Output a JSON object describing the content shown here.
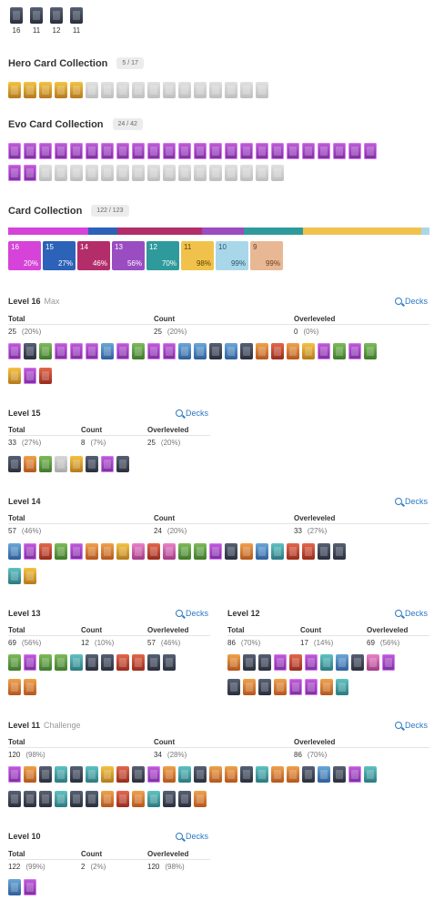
{
  "top_badges": [
    "16",
    "11",
    "12",
    "11"
  ],
  "hero": {
    "title": "Hero Card Collection",
    "count": "5 / 17"
  },
  "evo": {
    "title": "Evo Card Collection",
    "count": "24 / 42"
  },
  "collection": {
    "title": "Card Collection",
    "count": "122 / 123",
    "rarity_tiles": [
      {
        "level": "16",
        "pct": "20%",
        "color": "#d543d9",
        "fill": "#8b2d9b"
      },
      {
        "level": "15",
        "pct": "27%",
        "color": "#2c62b8",
        "fill": "#23408a"
      },
      {
        "level": "14",
        "pct": "46%",
        "color": "#b32d6a",
        "fill": "#8c1f4f"
      },
      {
        "level": "13",
        "pct": "56%",
        "color": "#9a4cc1",
        "fill": "#6e3092"
      },
      {
        "level": "12",
        "pct": "70%",
        "color": "#2f9a9c",
        "fill": "#1f6d72"
      },
      {
        "level": "11",
        "pct": "98%",
        "color": "#f1c24b",
        "fill": "#f1c24b"
      },
      {
        "level": "10",
        "pct": "99%",
        "color": "#a9d7ea",
        "fill": "#a9d7ea"
      },
      {
        "level": "9",
        "pct": "99%",
        "color": "#e8b895",
        "fill": "#e8b895"
      }
    ]
  },
  "labels": {
    "total": "Total",
    "count": "Count",
    "overleveled": "Overleveled",
    "decks": "Decks"
  },
  "levels": {
    "l16": {
      "title": "Level 16",
      "sub": "Max",
      "total": "25",
      "total_pct": "(20%)",
      "count": "25",
      "count_pct": "(20%)",
      "over": "0",
      "over_pct": "(0%)"
    },
    "l15": {
      "title": "Level 15",
      "total": "33",
      "total_pct": "(27%)",
      "count": "8",
      "count_pct": "(7%)",
      "over": "25",
      "over_pct": "(20%)"
    },
    "l14": {
      "title": "Level 14",
      "total": "57",
      "total_pct": "(46%)",
      "count": "24",
      "count_pct": "(20%)",
      "over": "33",
      "over_pct": "(27%)"
    },
    "l13": {
      "title": "Level 13",
      "total": "69",
      "total_pct": "(56%)",
      "count": "12",
      "count_pct": "(10%)",
      "over": "57",
      "over_pct": "(46%)"
    },
    "l12": {
      "title": "Level 12",
      "total": "86",
      "total_pct": "(70%)",
      "count": "17",
      "count_pct": "(14%)",
      "over": "69",
      "over_pct": "(56%)"
    },
    "l11": {
      "title": "Level 11",
      "sub": "Challenge",
      "total": "120",
      "total_pct": "(98%)",
      "count": "34",
      "count_pct": "(28%)",
      "over": "86",
      "over_pct": "(70%)"
    },
    "l10": {
      "title": "Level 10",
      "total": "122",
      "total_pct": "(99%)",
      "count": "2",
      "count_pct": "(2%)",
      "over": "120",
      "over_pct": "(98%)"
    }
  }
}
